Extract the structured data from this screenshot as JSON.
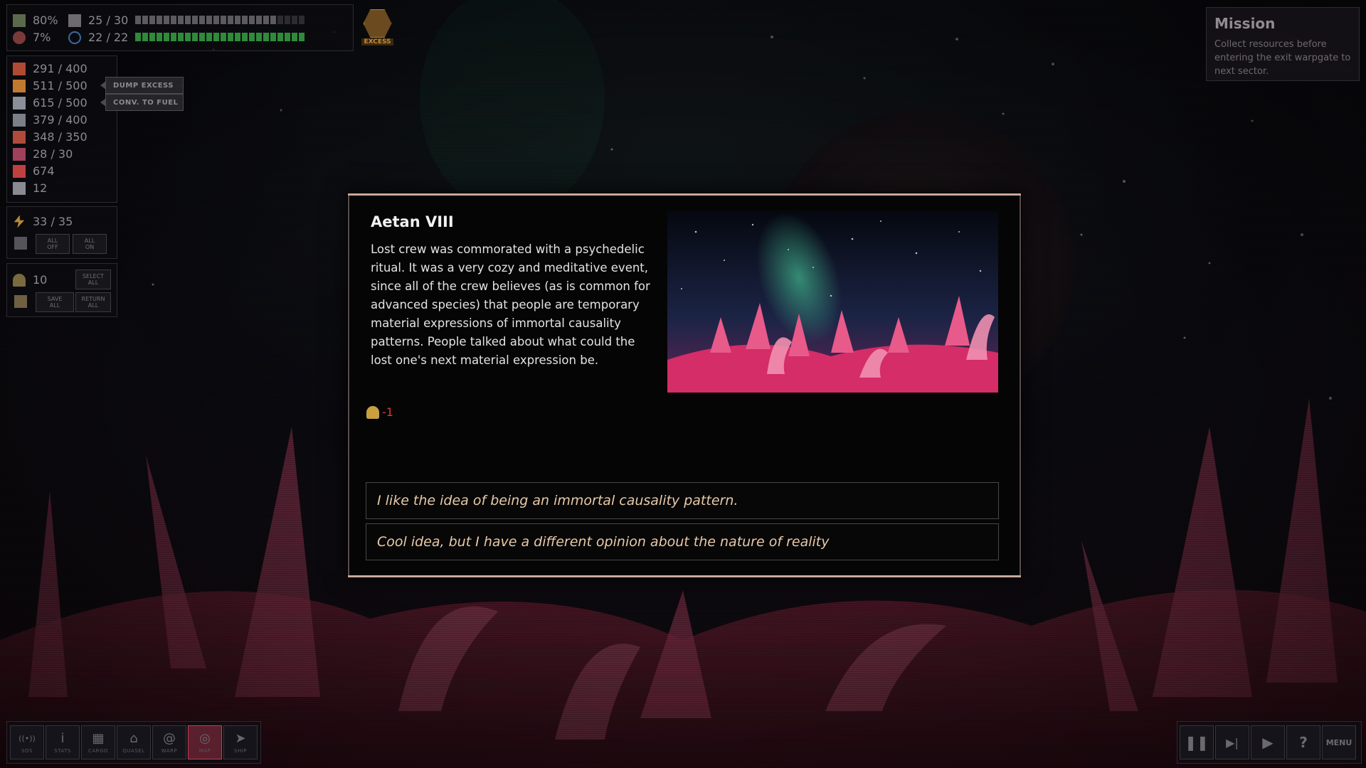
{
  "stats": {
    "hull_pct": "80%",
    "crew_capacity": "25 / 30",
    "damage_pct": "7%",
    "energy_capacity": "22 / 22"
  },
  "excess_badge": "EXCESS",
  "resources": [
    {
      "icon": "food-icon",
      "value": "291 / 400",
      "color": "#b04a32"
    },
    {
      "icon": "fuel-icon",
      "value": "511 / 500",
      "color": "#c07a30"
    },
    {
      "icon": "metal-icon",
      "value": "615 / 500",
      "color": "#8a8f9a"
    },
    {
      "icon": "crystals-icon",
      "value": "379 / 400",
      "color": "#7a7f88"
    },
    {
      "icon": "ammo-icon",
      "value": "348 / 350",
      "color": "#b04a3a"
    },
    {
      "icon": "exotics-icon",
      "value": "28 / 30",
      "color": "#a0405a"
    },
    {
      "icon": "credits-icon",
      "value": "674",
      "color": "#c04040"
    },
    {
      "icon": "research-icon",
      "value": "12",
      "color": "#8a8a92"
    }
  ],
  "cargo_actions": {
    "dump_excess": "DUMP EXCESS",
    "convert_fuel": "CONV. TO FUEL"
  },
  "power": {
    "value": "33 / 35",
    "all_off": "ALL\nOFF",
    "all_on": "ALL\nON"
  },
  "crew": {
    "count": "10",
    "select_all": "SELECT\nALL",
    "save_all": "SAVE\nALL",
    "return_all": "RETURN\nALL"
  },
  "mission": {
    "title": "Mission",
    "text": "Collect resources before entering the exit warpgate to next sector."
  },
  "event": {
    "title": "Aetan VIII",
    "body": "Lost crew was commorated with a psychedelic ritual. It was a very cozy and meditative event, since all of the crew believes (as is common for advanced species) that people are temporary material expressions of immortal causality patterns. People talked about what could the lost one's next material expression be.",
    "effect_value": "-1",
    "choices": [
      "I like the idea of being an immortal causality pattern.",
      "Cool idea, but I have a different opinion about the nature of reality"
    ]
  },
  "toolbar": [
    {
      "icon": "sos-icon",
      "label": "SOS",
      "glyph": "((•))"
    },
    {
      "icon": "info-icon",
      "label": "STATS",
      "glyph": "i"
    },
    {
      "icon": "cargo-icon",
      "label": "CARGO",
      "glyph": "▦"
    },
    {
      "icon": "quasel-icon",
      "label": "QUASEL",
      "glyph": "⌂"
    },
    {
      "icon": "warp-icon",
      "label": "WARP",
      "glyph": "@"
    },
    {
      "icon": "map-icon",
      "label": "MAP",
      "glyph": "◎"
    },
    {
      "icon": "ship-icon",
      "label": "SHIP",
      "glyph": "➤"
    }
  ],
  "controls": {
    "pause": "❚❚",
    "step": "▶|",
    "play": "▶",
    "help": "?",
    "menu": "MENU"
  }
}
